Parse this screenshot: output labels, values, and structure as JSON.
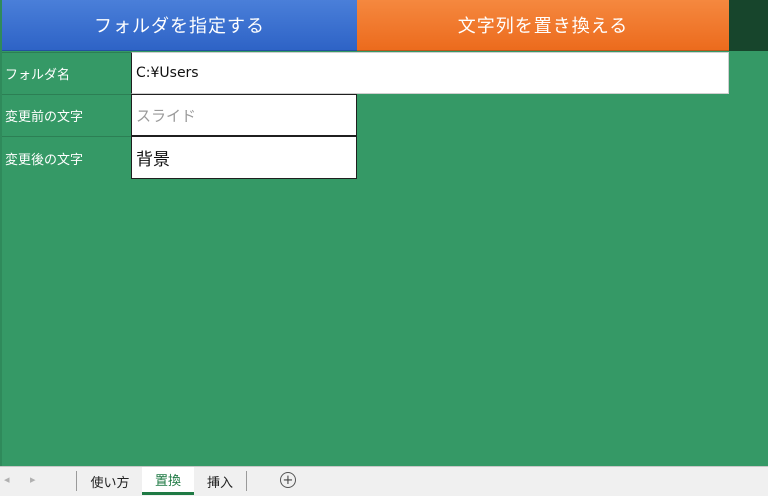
{
  "buttons": {
    "folder": "フォルダを指定する",
    "replace": "文字列を置き換える"
  },
  "fields": {
    "folder_label": "フォルダ名",
    "folder_value": "C:¥Users",
    "before_label": "変更前の文字",
    "before_value": "スライド",
    "after_label": "変更後の文字",
    "after_value": "背景"
  },
  "tabs": {
    "items": [
      "使い方",
      "置換",
      "挿入"
    ],
    "active": "置換",
    "nav_prev": "◂",
    "nav_next": "▸",
    "add": "+"
  },
  "colors": {
    "sheet_bg": "#359966",
    "folder_button": "#2e63c6",
    "replace_button": "#ec6b1d",
    "active_tab": "#1f7a44"
  }
}
